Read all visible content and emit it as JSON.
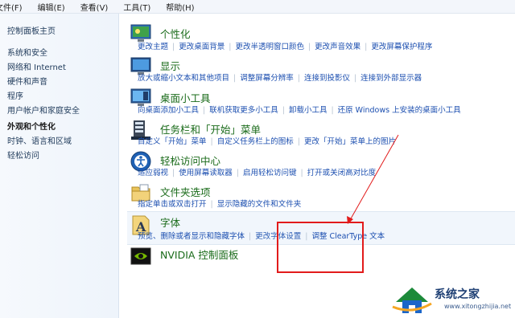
{
  "menubar": {
    "items": [
      "文件(F)",
      "编辑(E)",
      "查看(V)",
      "工具(T)",
      "帮助(H)"
    ]
  },
  "sidebar": {
    "items": [
      {
        "label": "控制面板主页"
      },
      {
        "label": "系统和安全"
      },
      {
        "label": "网络和 Internet"
      },
      {
        "label": "硬件和声音"
      },
      {
        "label": "程序"
      },
      {
        "label": "用户帐户和家庭安全"
      },
      {
        "label": "外观和个性化"
      },
      {
        "label": "时钟、语言和区域"
      },
      {
        "label": "轻松访问"
      }
    ]
  },
  "categories": [
    {
      "title": "个性化",
      "icon": "personalization-icon",
      "links": [
        "更改主题",
        "更改桌面背景",
        "更改半透明窗口颜色",
        "更改声音效果",
        "更改屏幕保护程序"
      ]
    },
    {
      "title": "显示",
      "icon": "display-icon",
      "links": [
        "放大或缩小文本和其他项目",
        "调整屏幕分辨率",
        "连接到投影仪",
        "连接到外部显示器"
      ]
    },
    {
      "title": "桌面小工具",
      "icon": "desktop-gadgets-icon",
      "links": [
        "向桌面添加小工具",
        "联机获取更多小工具",
        "卸载小工具",
        "还原 Windows 上安装的桌面小工具"
      ]
    },
    {
      "title": "任务栏和「开始」菜单",
      "icon": "taskbar-icon",
      "links": [
        "自定义「开始」菜单",
        "自定义任务栏上的图标",
        "更改「开始」菜单上的图片"
      ]
    },
    {
      "title": "轻松访问中心",
      "icon": "ease-of-access-icon",
      "links": [
        "适应弱视",
        "使用屏幕读取器",
        "启用轻松访问键",
        "打开或关闭高对比度"
      ]
    },
    {
      "title": "文件夹选项",
      "icon": "folder-options-icon",
      "links": [
        "指定单击或双击打开",
        "显示隐藏的文件和文件夹"
      ]
    },
    {
      "title": "字体",
      "icon": "fonts-icon",
      "links": [
        "预览、删除或者显示和隐藏字体",
        "更改字体设置",
        "调整 ClearType 文本"
      ]
    },
    {
      "title": "NVIDIA 控制面板",
      "icon": "nvidia-icon",
      "links": []
    }
  ],
  "watermark": {
    "text": "系统之家",
    "url": "www.xitongzhijia.net"
  },
  "colors": {
    "accent_red": "#e21b1b",
    "link": "#1c4fb0",
    "title_green": "#1a6b1a"
  }
}
